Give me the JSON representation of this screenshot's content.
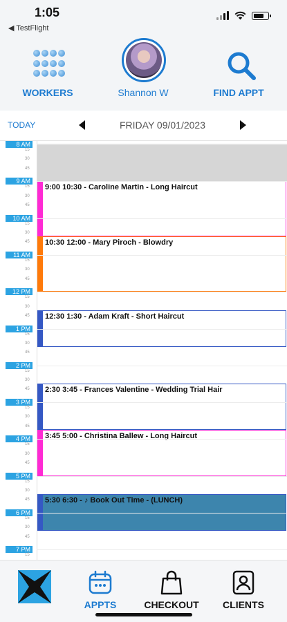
{
  "status_bar": {
    "time": "1:05",
    "back_app": "◀ TestFlight"
  },
  "topnav": {
    "workers_label": "WORKERS",
    "profile_name": "Shannon W",
    "find_label": "FIND APPT"
  },
  "datebar": {
    "today_label": "TODAY",
    "date": "FRIDAY 09/01/2023"
  },
  "calendar": {
    "hours": [
      {
        "label": "8 AM",
        "minutes": [
          "15",
          "30",
          "45"
        ]
      },
      {
        "label": "9 AM",
        "minutes": [
          "15",
          "30",
          "45"
        ]
      },
      {
        "label": "10 AM",
        "minutes": [
          "15",
          "30",
          "45"
        ]
      },
      {
        "label": "11 AM",
        "minutes": [
          "15",
          "30",
          "45"
        ]
      },
      {
        "label": "12 PM",
        "minutes": [
          "15",
          "30",
          "45"
        ]
      },
      {
        "label": "1 PM",
        "minutes": [
          "15",
          "30",
          "45"
        ]
      },
      {
        "label": "2 PM",
        "minutes": [
          "15",
          "30",
          "45"
        ]
      },
      {
        "label": "3 PM",
        "minutes": [
          "15",
          "30",
          "45"
        ]
      },
      {
        "label": "4 PM",
        "minutes": [
          "15",
          "30",
          "45"
        ]
      },
      {
        "label": "5 PM",
        "minutes": [
          "15",
          "30",
          "45"
        ]
      },
      {
        "label": "6 PM",
        "minutes": [
          "15",
          "30",
          "45"
        ]
      },
      {
        "label": "7 PM",
        "minutes": [
          "15",
          "30",
          "45"
        ]
      }
    ],
    "appointments": [
      {
        "text": "9:00 10:30 - Caroline Martin - Long Haircut",
        "color": "#ff2ad4"
      },
      {
        "text": "10:30 12:00 - Mary Piroch - Blowdry",
        "color": "#ff7a0a"
      },
      {
        "text": "12:30 1:30 - Adam Kraft - Short Haircut",
        "color": "#3558c4"
      },
      {
        "text": "2:30 3:45 - Frances Valentine - Wedding Trial Hair",
        "color": "#3558c4"
      },
      {
        "text": "3:45 5:00 - Christina Ballew - Long Haircut",
        "color": "#ff2ad4"
      },
      {
        "text": "5:30 6:30 - ♪ Book Out Time - (LUNCH)",
        "color": "#3558c4"
      }
    ]
  },
  "tabbar": {
    "appts_label": "APPTS",
    "checkout_label": "CHECKOUT",
    "clients_label": "CLIENTS"
  },
  "colors": {
    "accent": "#1d7bd0",
    "hour_label_bg": "#2ca3e2",
    "blocked_bg": "#d6d6d6",
    "lunch_bg": "#3d85ad"
  }
}
